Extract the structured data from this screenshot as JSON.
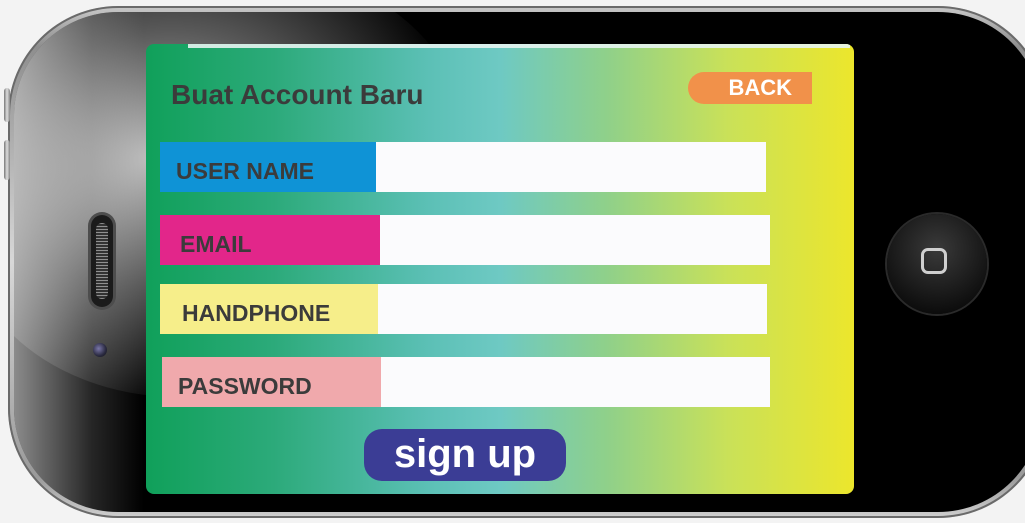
{
  "screen": {
    "title": "Buat Account Baru",
    "back_label": "BACK",
    "signup_label": "sign up"
  },
  "fields": [
    {
      "label": "USER NAME",
      "value": "",
      "color": "#0f93d6"
    },
    {
      "label": "EMAIL",
      "value": "",
      "color": "#e2268a"
    },
    {
      "label": "HANDPHONE",
      "value": "",
      "color": "#f6ee8a"
    },
    {
      "label": "PASSWORD",
      "value": "",
      "color": "#f0a9ac"
    }
  ],
  "colors": {
    "back_button": "#f1914a",
    "signup_button": "#3b3d95",
    "gradient_start": "#10a05a",
    "gradient_end": "#ece62c"
  },
  "icons": {
    "home_button": "home-square-icon",
    "speaker": "speaker-grill-icon",
    "camera": "front-camera-icon"
  }
}
